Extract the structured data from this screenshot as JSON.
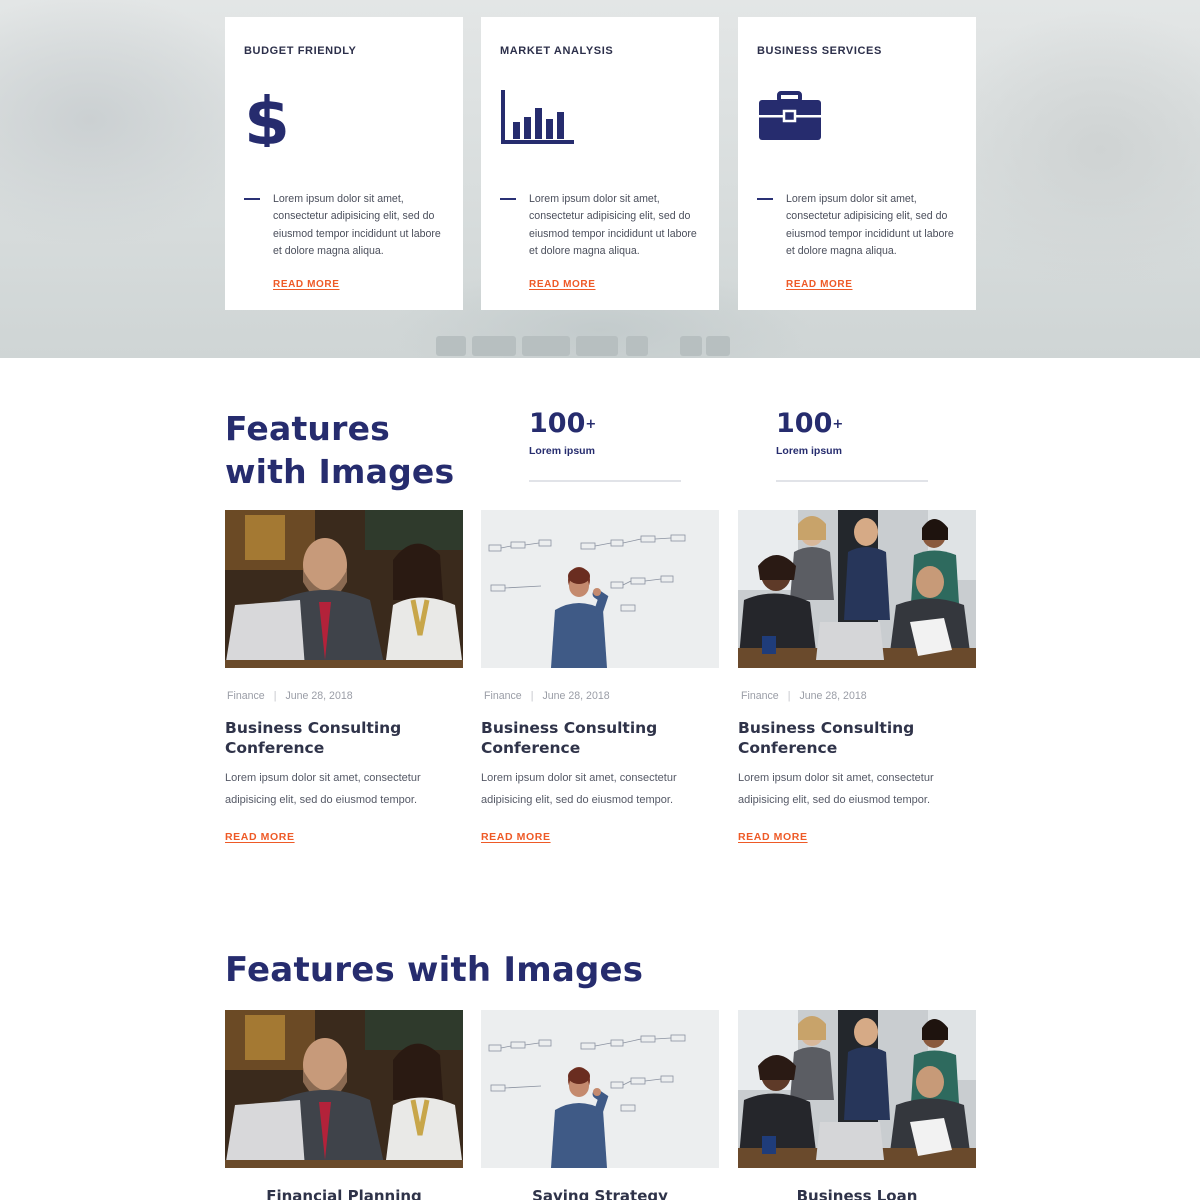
{
  "hero": {
    "cards": [
      {
        "title": "BUDGET FRIENDLY",
        "icon": "dollar-icon",
        "text": "Lorem ipsum dolor sit amet, consectetur adipisicing elit, sed do eiusmod tempor incididunt ut labore et dolore magna aliqua.",
        "link": "READ MORE"
      },
      {
        "title": "MARKET ANALYSIS",
        "icon": "bar-chart-icon",
        "text": "Lorem ipsum dolor sit amet, consectetur adipisicing elit, sed do eiusmod tempor incididunt ut labore et dolore magna aliqua.",
        "link": "READ MORE"
      },
      {
        "title": "BUSINESS SERVICES",
        "icon": "briefcase-icon",
        "text": "Lorem ipsum dolor sit amet, consectetur adipisicing elit, sed do eiusmod tempor incididunt ut labore et dolore magna aliqua.",
        "link": "READ MORE"
      }
    ]
  },
  "features": {
    "title_line1": "Features",
    "title_line2": "with Images",
    "stats": [
      {
        "number": "100",
        "sup": "+",
        "label": "Lorem ipsum"
      },
      {
        "number": "100",
        "sup": "+",
        "label": "Lorem ipsum"
      }
    ],
    "posts": [
      {
        "category": "Finance",
        "separator": "|",
        "date": "June 28, 2018",
        "title": "Business Consulting Conference",
        "text": "Lorem ipsum dolor sit amet, consectetur adipisicing elit, sed do eiusmod tempor.",
        "link": "READ MORE"
      },
      {
        "category": "Finance",
        "separator": "|",
        "date": "June 28, 2018",
        "title": "Business Consulting Conference",
        "text": "Lorem ipsum dolor sit amet, consectetur adipisicing elit, sed do eiusmod tempor.",
        "link": "READ MORE"
      },
      {
        "category": "Finance",
        "separator": "|",
        "date": "June 28, 2018",
        "title": "Business Consulting Conference",
        "text": "Lorem ipsum dolor sit amet, consectetur adipisicing elit, sed do eiusmod tempor.",
        "link": "READ MORE"
      }
    ]
  },
  "features2": {
    "title": "Features with Images",
    "items": [
      {
        "title": "Financial Planning"
      },
      {
        "title": "Saving Strategy"
      },
      {
        "title": "Business Loan"
      }
    ]
  },
  "colors": {
    "navy": "#262c6e",
    "accent": "#ee5a27",
    "text": "#555966"
  }
}
